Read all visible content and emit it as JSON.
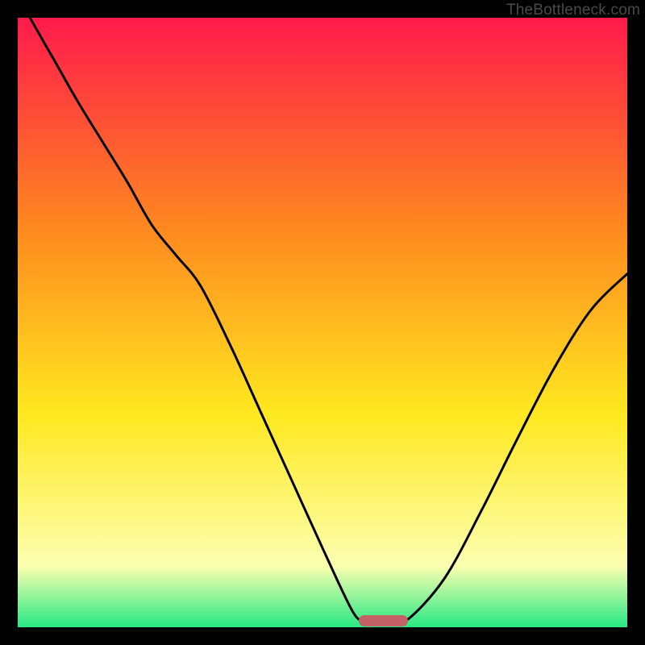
{
  "attribution": "TheBottleneck.com",
  "colors": {
    "gradient_top": "#ff1a4b",
    "gradient_mid1": "#ff8a1f",
    "gradient_mid2": "#ffe81f",
    "gradient_low": "#fbffb0",
    "gradient_bottom": "#27e884",
    "curve": "#000000",
    "marker_fill": "#c36167",
    "frame": "#000000"
  },
  "chart_data": {
    "type": "line",
    "title": "",
    "xlabel": "",
    "ylabel": "",
    "xlim": [
      0,
      100
    ],
    "ylim": [
      0,
      100
    ],
    "series": [
      {
        "name": "bottleneck-curve",
        "x": [
          2,
          6,
          10,
          14,
          18,
          22,
          26,
          30,
          35,
          40,
          45,
          50,
          55,
          57,
          59,
          61,
          64,
          70,
          76,
          82,
          88,
          94,
          100
        ],
        "y": [
          100,
          93,
          86,
          79.5,
          73,
          66,
          61,
          56,
          46,
          35,
          24,
          13,
          2.5,
          1.2,
          1.0,
          1.0,
          1.3,
          8,
          19,
          31,
          42.5,
          52,
          58
        ]
      }
    ],
    "marker": {
      "name": "optimal-range",
      "x_center": 60.0,
      "y": 1.0,
      "width_x": 8.0
    },
    "grid": false,
    "legend": null
  }
}
